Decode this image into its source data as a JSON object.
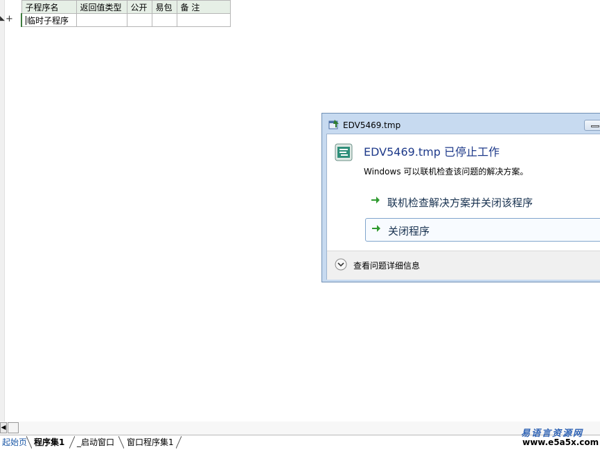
{
  "table": {
    "headers": [
      "子程序名",
      "返回值类型",
      "公开",
      "易包",
      "备 注"
    ],
    "row": [
      "临时子程序",
      "",
      "",
      "",
      ""
    ]
  },
  "gutter": {
    "plus": "+"
  },
  "dialog": {
    "title": "EDV5469.tmp",
    "heading": "EDV5469.tmp 已停止工作",
    "description": "Windows 可以联机检查该问题的解决方案。",
    "actions": [
      {
        "label": "联机检查解决方案并关闭该程序",
        "icon": "green-arrow-icon"
      },
      {
        "label": "关闭程序",
        "icon": "green-arrow-icon"
      }
    ],
    "details_label": "查看问题详细信息",
    "accent": "#1e3a8a"
  },
  "tabs": [
    {
      "label": "起始页"
    },
    {
      "label": "程序集1"
    },
    {
      "label": "_启动窗口"
    },
    {
      "label": "窗口程序集1"
    }
  ],
  "watermark": {
    "site_name": "易语言资源网",
    "url": "www.e5a5x.com"
  }
}
